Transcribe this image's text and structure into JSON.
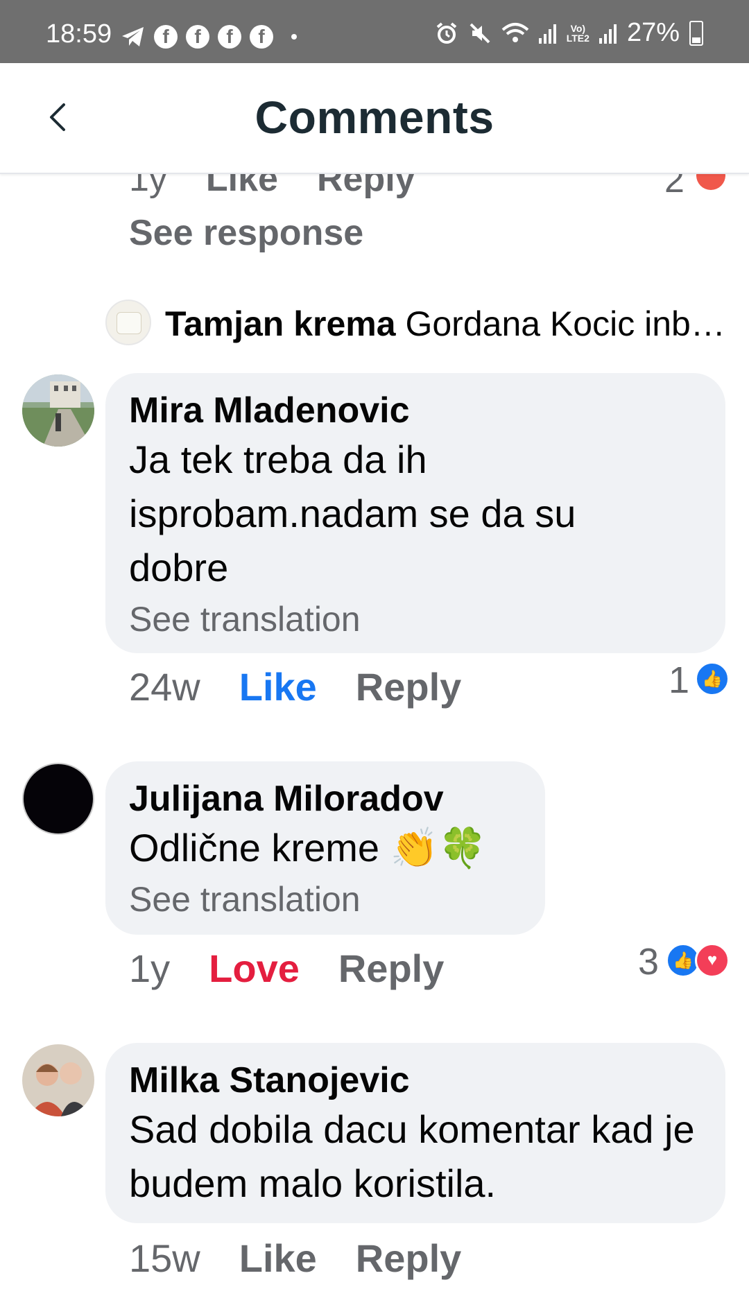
{
  "status_bar": {
    "time": "18:59",
    "network_label": "Vo)\nLTE2",
    "battery": "27%",
    "icons": [
      "telegram-icon",
      "facebook-icon",
      "facebook-icon",
      "facebook-icon",
      "facebook-icon",
      "alarm-icon",
      "mute-icon",
      "wifi-icon",
      "signal-icon",
      "signal-icon",
      "battery-icon"
    ]
  },
  "header": {
    "title": "Comments",
    "back_icon": "chevron-left-icon"
  },
  "previous_reply": {
    "time": "1y",
    "like_label": "Like",
    "reply_label": "Reply",
    "reaction_count": "2",
    "see_response": "See response"
  },
  "product_reply": {
    "name": "Tamjan krema",
    "text": "Gordana Kocic inb…"
  },
  "comments": [
    {
      "name": "Mira Mladenovic",
      "text": "Ja tek treba da ih isprobam.nadam se da su dobre",
      "translation": "See translation",
      "time": "24w",
      "reaction_label": "Like",
      "reply_label": "Reply",
      "reaction_count": "1"
    },
    {
      "name": "Julijana Miloradov",
      "text": "Odlične kreme 👏🍀",
      "translation": "See translation",
      "time": "1y",
      "reaction_label": "Love",
      "reply_label": "Reply",
      "reaction_count": "3"
    },
    {
      "name": "Milka Stanojevic",
      "text": "Sad dobila dacu komentar kad je budem malo koristila.",
      "time": "15w",
      "reaction_label": "Like",
      "reply_label": "Reply"
    }
  ],
  "colors": {
    "status_bar": "#6f6f6f",
    "bubble": "#f0f2f5",
    "like_blue": "#1877f2",
    "love_red": "#e41e3f",
    "secondary_text": "#65676b"
  }
}
